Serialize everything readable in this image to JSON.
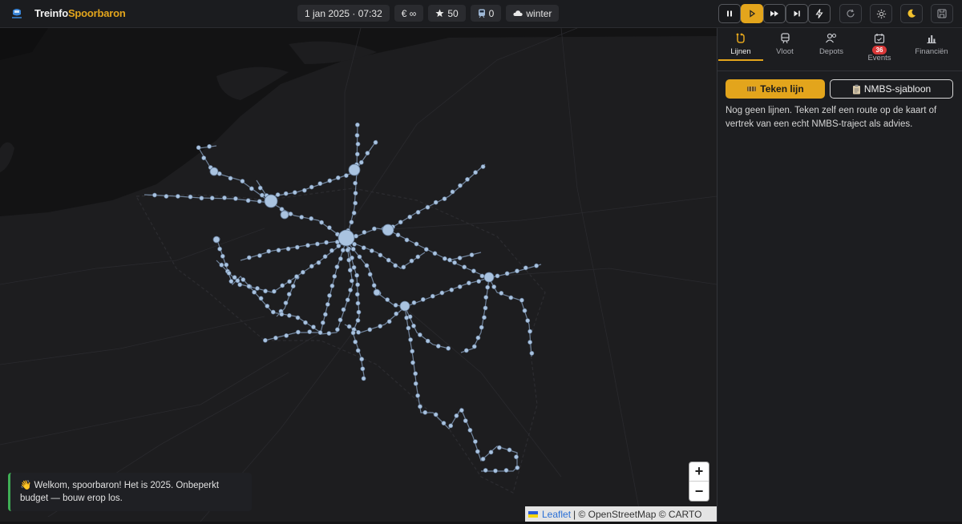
{
  "app": {
    "brand_part1": "Treinfo",
    "brand_part2": "Spoorbaron"
  },
  "stats": {
    "datetime": "1 jan 2025 · 07:32",
    "money": "€ ∞",
    "stars": "50",
    "trains": "0",
    "season": "winter"
  },
  "tabs": [
    {
      "label": "Lijnen",
      "icon": "route-icon"
    },
    {
      "label": "Vloot",
      "icon": "train-icon"
    },
    {
      "label": "Depots",
      "icon": "people-icon"
    },
    {
      "label": "Events",
      "icon": "calendar-icon",
      "badge": "36"
    },
    {
      "label": "Financiën",
      "icon": "bar-chart-icon"
    }
  ],
  "panel": {
    "draw_line": "Teken lijn",
    "template": "NMBS-sjabloon",
    "empty_text": "Nog geen lijnen. Teken zelf een route op de kaart of vertrek van een echt NMBS-traject als advies."
  },
  "toast": {
    "text": "👋 Welkom, spoorbaron! Het is 2025. Onbeperkt budget — bouw erop los."
  },
  "map": {
    "zoom_in": "+",
    "zoom_out": "−",
    "attribution_link": "Leaflet",
    "attribution_rest": "| © OpenStreetMap © CARTO"
  },
  "colors": {
    "accent": "#e3a51c",
    "station": "#a9c3e0",
    "success": "#3fae55",
    "badge": "#d93838"
  }
}
